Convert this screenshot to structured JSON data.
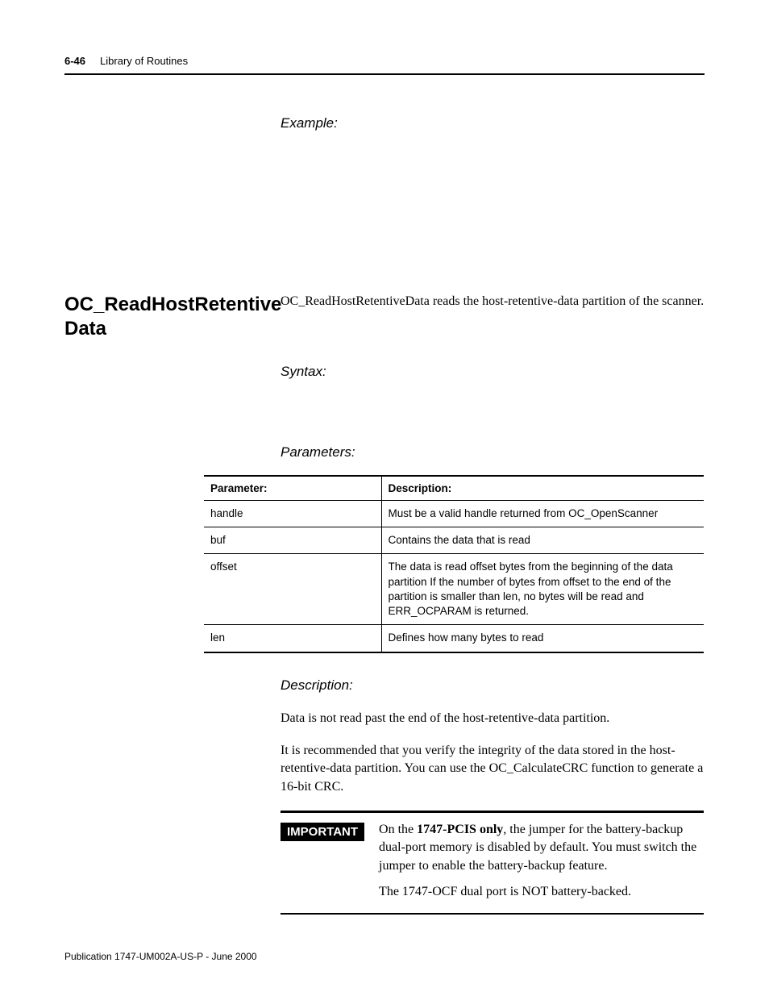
{
  "header": {
    "page_num": "6-46",
    "title": "Library of Routines"
  },
  "example_label": "Example:",
  "section": {
    "title": "OC_ReadHostRetentive Data",
    "intro": "OC_ReadHostRetentiveData reads the host-retentive-data partition of the scanner."
  },
  "syntax_label": "Syntax:",
  "parameters_label": "Parameters:",
  "param_table": {
    "headers": [
      "Parameter:",
      "Description:"
    ],
    "rows": [
      {
        "param": "handle",
        "desc": "Must be a valid handle returned from OC_OpenScanner"
      },
      {
        "param": "buf",
        "desc": "Contains the data that is read"
      },
      {
        "param": "offset",
        "desc": "The data is read offset bytes from the beginning of the data partition\nIf the number of bytes from offset to the end of the partition is smaller than len, no bytes will be read and ERR_OCPARAM is returned."
      },
      {
        "param": "len",
        "desc": "Defines how many bytes to read"
      }
    ]
  },
  "description_label": "Description:",
  "desc_paragraphs": [
    "Data is not read past the end of the host-retentive-data partition.",
    "It is recommended that you verify the integrity of the data stored in the host-retentive-data partition. You can use the OC_CalculateCRC function to generate a 16-bit CRC."
  ],
  "important": {
    "badge": "IMPORTANT",
    "p1_prefix": "On the ",
    "p1_bold": "1747-PCIS only",
    "p1_suffix": ", the jumper for the battery-backup dual-port memory is disabled by default. You must switch the jumper to enable the battery-backup feature.",
    "p2": "The 1747-OCF dual port is NOT battery-backed."
  },
  "footer": "Publication 1747-UM002A-US-P - June 2000"
}
